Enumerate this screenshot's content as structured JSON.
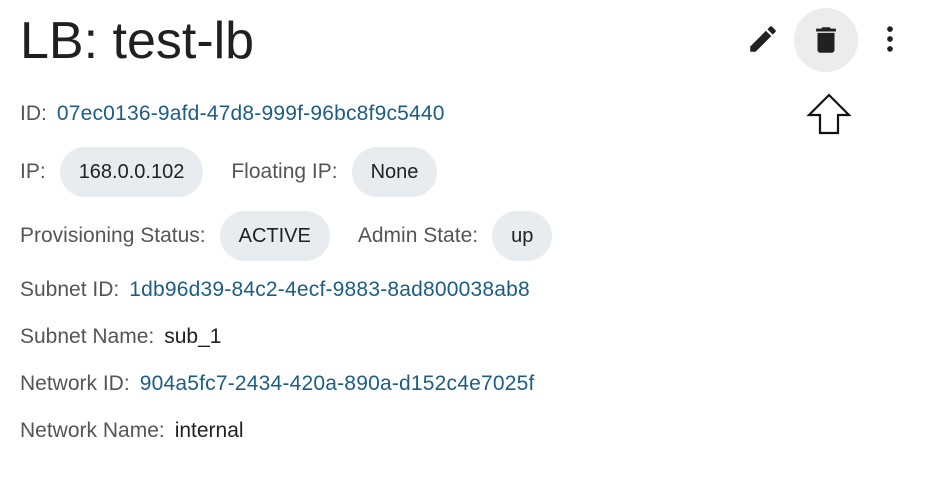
{
  "header": {
    "title": "LB: test-lb"
  },
  "actions": {
    "edit_icon": "pencil-icon",
    "delete_icon": "trash-icon",
    "more_icon": "more-vertical-icon"
  },
  "details": {
    "id_label": "ID:",
    "id_value": "07ec0136-9afd-47d8-999f-96bc8f9c5440",
    "ip_label": "IP:",
    "ip_value": "168.0.0.102",
    "floating_ip_label": "Floating IP:",
    "floating_ip_value": "None",
    "provisioning_status_label": "Provisioning Status:",
    "provisioning_status_value": "ACTIVE",
    "admin_state_label": "Admin State:",
    "admin_state_value": "up",
    "subnet_id_label": "Subnet ID:",
    "subnet_id_value": "1db96d39-84c2-4ecf-9883-8ad800038ab8",
    "subnet_name_label": "Subnet Name:",
    "subnet_name_value": "sub_1",
    "network_id_label": "Network ID:",
    "network_id_value": "904a5fc7-2434-420a-890a-d152c4e7025f",
    "network_name_label": "Network Name:",
    "network_name_value": "internal"
  },
  "colors": {
    "link": "#1c5d85",
    "chip_background": "#e8ecef",
    "hover_background": "#ececec"
  }
}
